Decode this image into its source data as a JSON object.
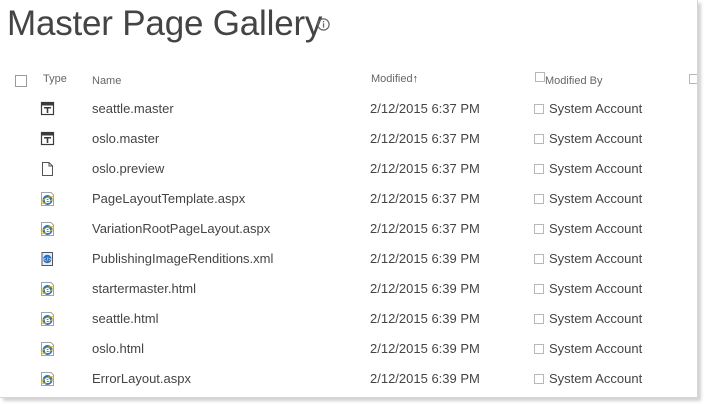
{
  "page": {
    "title": "Master Page Gallery"
  },
  "columns": {
    "type": "Type",
    "name": "Name",
    "modified": "Modified",
    "sort_indicator": "↑",
    "modified_by": "Modified By"
  },
  "rows": [
    {
      "icon": "master-page-icon",
      "name": "seattle.master",
      "modified": "2/12/2015 6:37 PM",
      "modified_by": "System Account"
    },
    {
      "icon": "master-page-icon",
      "name": "oslo.master",
      "modified": "2/12/2015 6:37 PM",
      "modified_by": "System Account"
    },
    {
      "icon": "blank-file-icon",
      "name": "oslo.preview",
      "modified": "2/12/2015 6:37 PM",
      "modified_by": "System Account"
    },
    {
      "icon": "aspx-file-icon",
      "name": "PageLayoutTemplate.aspx",
      "modified": "2/12/2015 6:37 PM",
      "modified_by": "System Account"
    },
    {
      "icon": "aspx-file-icon",
      "name": "VariationRootPageLayout.aspx",
      "modified": "2/12/2015 6:37 PM",
      "modified_by": "System Account"
    },
    {
      "icon": "xml-file-icon",
      "name": "PublishingImageRenditions.xml",
      "modified": "2/12/2015 6:39 PM",
      "modified_by": "System Account"
    },
    {
      "icon": "html-file-icon",
      "name": "startermaster.html",
      "modified": "2/12/2015 6:39 PM",
      "modified_by": "System Account"
    },
    {
      "icon": "html-file-icon",
      "name": "seattle.html",
      "modified": "2/12/2015 6:39 PM",
      "modified_by": "System Account"
    },
    {
      "icon": "html-file-icon",
      "name": "oslo.html",
      "modified": "2/12/2015 6:39 PM",
      "modified_by": "System Account"
    },
    {
      "icon": "aspx-file-icon",
      "name": "ErrorLayout.aspx",
      "modified": "2/12/2015 6:39 PM",
      "modified_by": "System Account"
    }
  ],
  "colors": {
    "text": "#444444",
    "header_text": "#666666",
    "ie_blue": "#2a72c8",
    "icon_dark": "#3b3b3b"
  }
}
